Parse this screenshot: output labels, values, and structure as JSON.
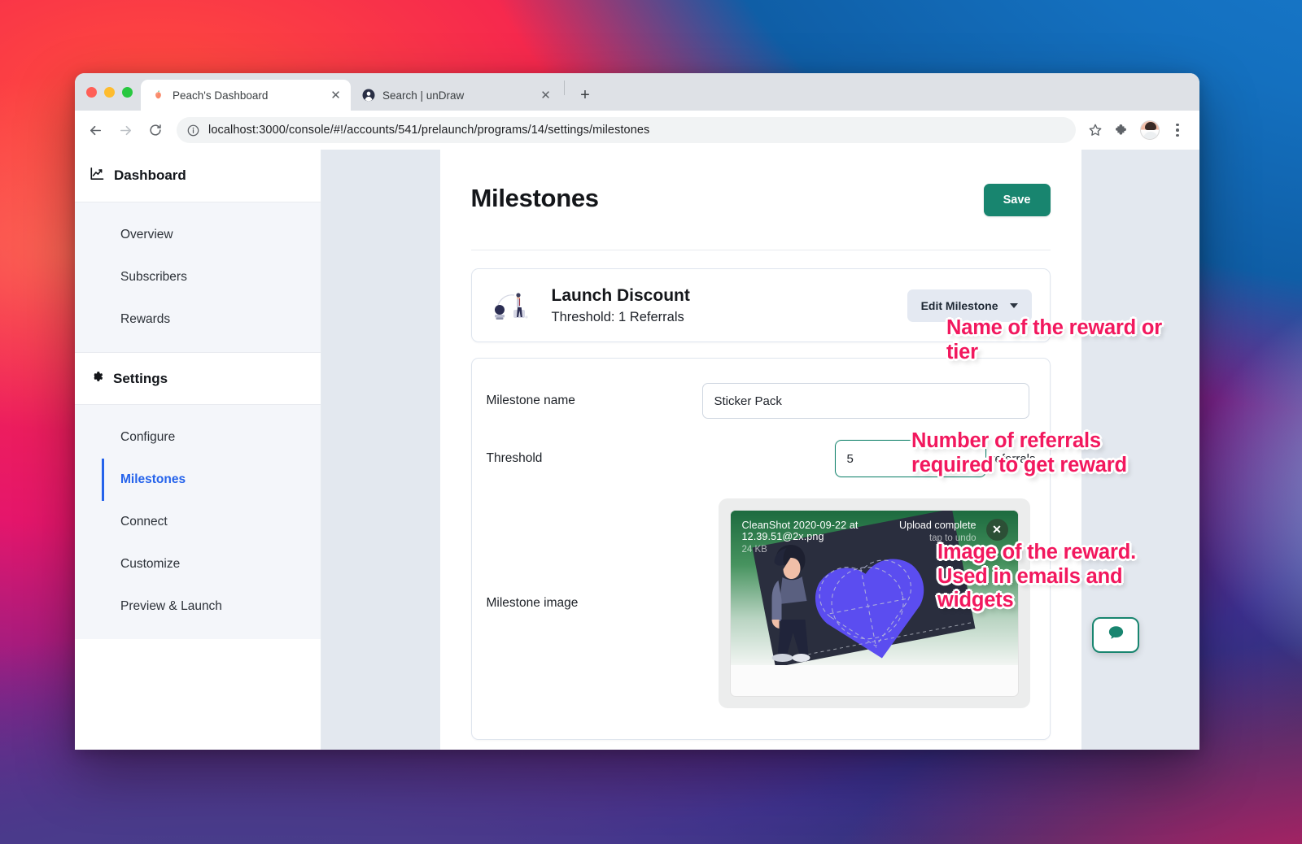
{
  "browser": {
    "tabs": [
      {
        "title": "Peach's Dashboard",
        "favicon": "peach-icon",
        "active": true,
        "close_label": "✕"
      },
      {
        "title": "Search | unDraw",
        "favicon": "undraw-icon",
        "active": false,
        "close_label": "✕"
      }
    ],
    "new_tab_label": "+",
    "nav": {
      "back": "←",
      "forward": "→",
      "reload": "↻"
    },
    "url": "localhost:3000/console/#!/accounts/541/prelaunch/programs/14/settings/milestones",
    "icons": {
      "info": "info-icon",
      "bookmark": "star-icon",
      "extensions": "puzzle-icon",
      "profile": "avatar",
      "menu": "kebab-menu-icon"
    }
  },
  "sidebar": {
    "groups": [
      {
        "label": "Dashboard",
        "icon": "chart-line-icon",
        "items": [
          {
            "label": "Overview",
            "active": false
          },
          {
            "label": "Subscribers",
            "active": false
          },
          {
            "label": "Rewards",
            "active": false
          }
        ]
      },
      {
        "label": "Settings",
        "icon": "gear-icon",
        "items": [
          {
            "label": "Configure",
            "active": false
          },
          {
            "label": "Milestones",
            "active": true
          },
          {
            "label": "Connect",
            "active": false
          },
          {
            "label": "Customize",
            "active": false
          },
          {
            "label": "Preview & Launch",
            "active": false
          }
        ]
      }
    ]
  },
  "main": {
    "title": "Milestones",
    "save_label": "Save",
    "milestone_card": {
      "name": "Launch Discount",
      "threshold_text": "Threshold: 1 Referrals",
      "edit_label": "Edit Milestone"
    },
    "form": {
      "name_label": "Milestone name",
      "name_value": "Sticker Pack",
      "threshold_label": "Threshold",
      "threshold_value": "5",
      "threshold_unit": "referrals",
      "image_label": "Milestone image",
      "upload": {
        "filename": "CleanShot 2020-09-22 at 12.39.51@2x.png",
        "filesize": "24 KB",
        "status": "Upload complete",
        "undo": "tap to undo",
        "close_label": "✕"
      }
    }
  },
  "annotations": [
    {
      "id": "ann1",
      "text": "Name of the reward or tier"
    },
    {
      "id": "ann2",
      "text": "Number of referrals required to get reward"
    },
    {
      "id": "ann3",
      "text": "Image of the reward. Used in emails and widgets"
    }
  ],
  "colors": {
    "accent_teal": "#18856f",
    "sidebar_active": "#2563eb",
    "annotation_pink": "#f2185e"
  }
}
